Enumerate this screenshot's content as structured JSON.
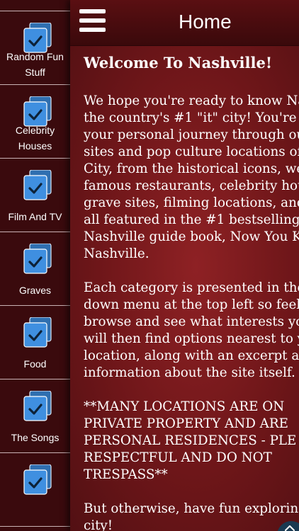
{
  "colors": {
    "sidebar_bg": "#3a0a0d",
    "main_bg": "#7a191c",
    "header_bg": "#4a0c0f",
    "icon_blue": "#3f8fe0",
    "text": "#ffffff"
  },
  "sidebar": {
    "items": [
      {
        "label": "Random Fun Stuff",
        "icon": "checkbox-tile-icon"
      },
      {
        "label": "Celebrity Houses",
        "icon": "checkbox-tile-icon"
      },
      {
        "label": "Film And TV",
        "icon": "checkbox-tile-icon"
      },
      {
        "label": "Graves",
        "icon": "checkbox-tile-icon"
      },
      {
        "label": "Food",
        "icon": "checkbox-tile-icon"
      },
      {
        "label": "The Songs",
        "icon": "checkbox-tile-icon"
      },
      {
        "label": "",
        "icon": "checkbox-tile-icon"
      }
    ]
  },
  "header": {
    "menu_icon": "hamburger-menu-icon",
    "title": "Home"
  },
  "content": {
    "heading": "Welcome To Nashville!",
    "paragraphs": [
      {
        "lines": [
          "We hope you're ready to know Na",
          "the country's #1 \"it\" city!  You're",
          "your personal journey through ou",
          "sites and pop culture locations of",
          "City, from the historical icons, we",
          "famous restaurants, celebrity hou",
          "grave sites, filming locations, and",
          "all featured in the #1 bestselling",
          "Nashville guide book, Now You K",
          "Nashville."
        ]
      },
      {
        "lines": [
          "Each category is presented in the",
          "down menu at the top left so feel",
          "browse and see what interests yo",
          "will then find options nearest to y",
          "location, along with an excerpt an",
          "information about the site itself."
        ]
      },
      {
        "lines": [
          "**MANY  LOCATIONS ARE ON",
          "PRIVATE PROPERTY AND ARE",
          "PERSONAL RESIDENCES - PLE",
          "RESPECTFUL AND DO NOT",
          "TRESPASS**"
        ]
      },
      {
        "lines": [
          "But otherwise, have fun exploring",
          "city!"
        ]
      }
    ]
  },
  "fab": {
    "icon": "chevron-up-icon"
  }
}
